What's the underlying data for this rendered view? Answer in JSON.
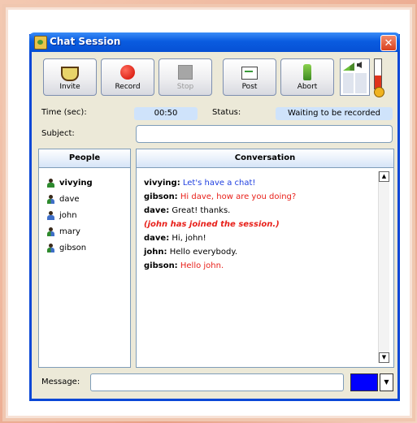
{
  "window": {
    "title": "Chat Session"
  },
  "toolbar": {
    "invite_label": "Invite",
    "record_label": "Record",
    "stop_label": "Stop",
    "post_label": "Post",
    "abort_label": "Abort"
  },
  "meter": {
    "mic_level": 0.45
  },
  "session": {
    "time_label": "Time (sec):",
    "time_value": "00:50",
    "status_label": "Status:",
    "status_value": "Waiting to be recorded",
    "subject_label": "Subject:",
    "subject_value": ""
  },
  "people": {
    "header": "People",
    "list": [
      "vivying",
      "dave",
      "john",
      "mary",
      "gibson"
    ]
  },
  "conversation": {
    "header": "Conversation",
    "messages": [
      {
        "who": "vivying:",
        "text": "Let's have a chat!"
      },
      {
        "who": "gibson:",
        "text": "Hi dave, how are you doing?"
      },
      {
        "who": "dave:",
        "text": "Great! thanks."
      },
      {
        "system": "(john has joined the session.)"
      },
      {
        "who": "dave:",
        "text": "Hi, john!"
      },
      {
        "who": "john:",
        "text": "Hello everybody."
      },
      {
        "who": "gibson:",
        "text": "Hello john."
      }
    ]
  },
  "composer": {
    "message_label": "Message:",
    "message_value": "",
    "text_color": "#0000ff"
  },
  "colors": {
    "titlebar": "#0a5ce0",
    "self_message": "#1f3fe0",
    "other_message": "#e8201a"
  }
}
